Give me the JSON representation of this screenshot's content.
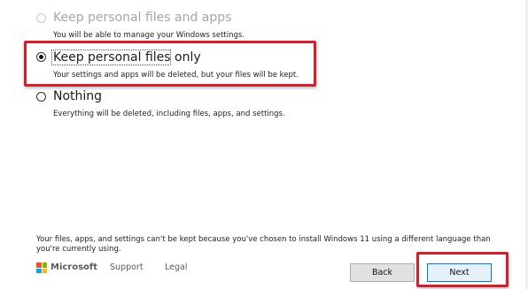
{
  "options": [
    {
      "title": "Keep personal files and apps",
      "description": "You will be able to manage your Windows settings.",
      "state": "disabled"
    },
    {
      "title": "Keep personal files only",
      "description": "Your settings and apps will be deleted, but your files will be kept.",
      "state": "selected"
    },
    {
      "title": "Nothing",
      "description": "Everything will be deleted, including files, apps, and settings.",
      "state": "unselected"
    }
  ],
  "note": "Your files, apps, and settings can't be kept because you've chosen to install  Windows 11 using a different language than you're currently using.",
  "footer": {
    "brand": "Microsoft",
    "links": [
      "Support",
      "Legal"
    ],
    "back_label": "Back",
    "next_label": "Next"
  },
  "colors": {
    "highlight_red": "#d4202a",
    "ms_red": "#f25022",
    "ms_green": "#7fba00",
    "ms_blue": "#00a4ef",
    "ms_yellow": "#ffb900"
  }
}
